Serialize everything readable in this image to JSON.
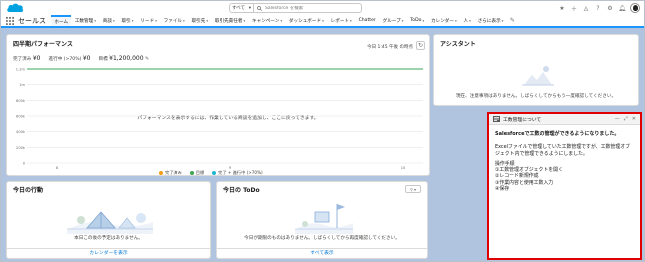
{
  "header": {
    "search_scope": "すべて",
    "search_placeholder": "Salesforce を検索"
  },
  "nav": {
    "app_name": "セールス",
    "tabs": [
      {
        "label": "ホーム",
        "chevron": false,
        "active": true
      },
      {
        "label": "工数管理",
        "chevron": true
      },
      {
        "label": "商談",
        "chevron": true
      },
      {
        "label": "取引",
        "chevron": true
      },
      {
        "label": "リード",
        "chevron": true
      },
      {
        "label": "ファイル",
        "chevron": true
      },
      {
        "label": "取引先",
        "chevron": true
      },
      {
        "label": "取引先責任者",
        "chevron": true
      },
      {
        "label": "キャンペーン",
        "chevron": true
      },
      {
        "label": "ダッシュボード",
        "chevron": true
      },
      {
        "label": "レポート",
        "chevron": true
      },
      {
        "label": "Chatter",
        "chevron": false
      },
      {
        "label": "グループ",
        "chevron": true
      },
      {
        "label": "ToDo",
        "chevron": true
      },
      {
        "label": "カレンダー",
        "chevron": true
      },
      {
        "label": "人",
        "chevron": true
      },
      {
        "label": "さらに表示",
        "chevron": true
      }
    ]
  },
  "performance": {
    "title": "四半期パフォーマンス",
    "status": "今日 1:45 午後 の時点",
    "closed_label": "完了済み",
    "closed_value": "¥0",
    "open_label": "進行中 (>70%)",
    "open_value": "¥0",
    "goal_label": "目標",
    "goal_value": "¥1,200,000",
    "empty_msg": "パフォーマンスを表示するには、作業している商談を追加し、ここに戻ってきます。",
    "legend": [
      {
        "label": "完了済み",
        "color": "#f59b16"
      },
      {
        "label": "目標",
        "color": "#3ba755"
      },
      {
        "label": "完了 + 進行中 (>70%)",
        "color": "#1eb8d1"
      }
    ]
  },
  "chart_data": {
    "type": "line",
    "x_ticks": [
      "8",
      "9",
      "10"
    ],
    "y_ticks": [
      "1.2m",
      "1m",
      "800k",
      "600k",
      "400k",
      "200k",
      "0"
    ],
    "series": [
      {
        "name": "目標",
        "values": [
          1200000,
          1200000,
          1200000
        ]
      }
    ],
    "legend": "bottom"
  },
  "assistant": {
    "title": "アシスタント",
    "empty_msg": "現在、注意事項はありません。しばらくしてからもう一度確認してください。"
  },
  "events": {
    "title": "今日の行動",
    "empty_msg": "本日この後の予定はありません。",
    "footer": "カレンダーを表示"
  },
  "todo": {
    "title": "今日の ToDo",
    "empty_msg": "今日が期限のものはありません。しばらくしてから再度確認してください。",
    "footer": "すべて表示"
  },
  "popup": {
    "title": "工数管理について",
    "lead": "Salesforceで工数の管理ができるようになりました。",
    "para1": "Excelファイルで管理していた工数管理ですが、工数管理オブジェクト内で管理できるようにしました。",
    "steps_title": "操作手順",
    "step1": "①工数管理オブジェクトを開く",
    "step2": "②レコード新規作成",
    "step3": "③作業内容と使用工数入力",
    "step4": "④保存"
  },
  "colors": {
    "brand": "#1b96ff",
    "link": "#0176d3",
    "highlight_border": "#e00000",
    "goal_line": "#3ba755"
  }
}
